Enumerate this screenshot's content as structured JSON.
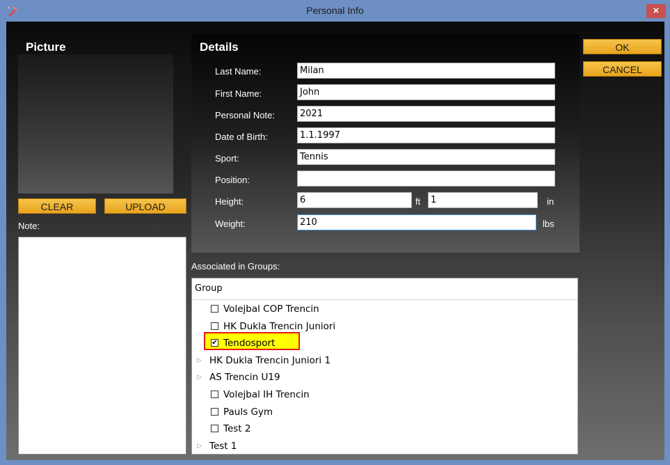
{
  "window": {
    "title": "Personal Info"
  },
  "picture": {
    "heading": "Picture",
    "clear_label": "CLEAR",
    "upload_label": "UPLOAD",
    "note_label": "Note:",
    "note_value": ""
  },
  "details": {
    "heading": "Details",
    "fields": {
      "last_name": {
        "label": "Last Name:",
        "value": "Milan"
      },
      "first_name": {
        "label": "First Name:",
        "value": "John"
      },
      "personal_note": {
        "label": "Personal Note:",
        "value": "2021"
      },
      "date_of_birth": {
        "label": "Date of Birth:",
        "value": "1.1.1997"
      },
      "sport": {
        "label": "Sport:",
        "value": "Tennis"
      },
      "position": {
        "label": "Position:",
        "value": ""
      },
      "height": {
        "label": "Height:",
        "feet": "6",
        "feet_unit": "ft",
        "inches": "1",
        "inches_unit": "in"
      },
      "weight": {
        "label": "Weight:",
        "value": "210",
        "unit": "lbs"
      }
    }
  },
  "actions": {
    "ok_label": "OK",
    "cancel_label": "CANCEL"
  },
  "groups": {
    "label": "Associated in Groups:",
    "column_header": "Group",
    "items": [
      {
        "name": "Volejbal COP Trencin",
        "kind": "checkbox",
        "checked": false
      },
      {
        "name": "HK Dukla Trencin Juniori",
        "kind": "checkbox",
        "checked": false
      },
      {
        "name": "Tendosport",
        "kind": "checkbox",
        "checked": true
      },
      {
        "name": "HK Dukla Trencin Juniori 1",
        "kind": "expander"
      },
      {
        "name": "AS Trencin U19",
        "kind": "expander"
      },
      {
        "name": "Volejbal IH Trencin",
        "kind": "checkbox",
        "checked": false
      },
      {
        "name": "Pauls Gym",
        "kind": "checkbox",
        "checked": false
      },
      {
        "name": "Test 2",
        "kind": "checkbox",
        "checked": false
      },
      {
        "name": "Test 1",
        "kind": "expander"
      }
    ],
    "check_mark": "✔",
    "expander_glyph": "▷"
  },
  "colors": {
    "accent_gold": "#f3b73a",
    "highlight": "#ffff00",
    "highlight_border": "#e21b1b",
    "close": "#c75050"
  }
}
